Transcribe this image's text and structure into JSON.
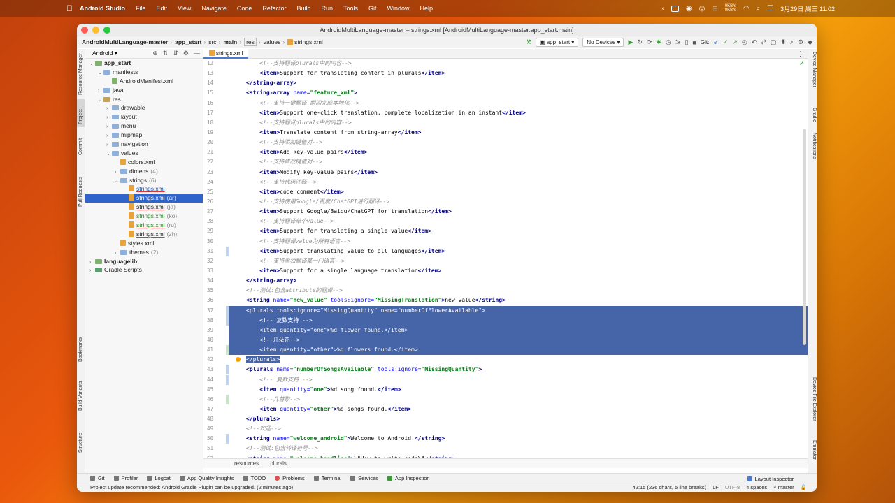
{
  "menubar": {
    "app_name": "Android Studio",
    "items": [
      "File",
      "Edit",
      "View",
      "Navigate",
      "Code",
      "Refactor",
      "Build",
      "Run",
      "Tools",
      "Git",
      "Window",
      "Help"
    ],
    "net_up": "0KB/s",
    "net_down": "0KB/s",
    "clock": "3月29日 周三  11:02"
  },
  "window": {
    "title": "AndroidMultiLanguage-master – strings.xml [AndroidMultiLanguage-master.app_start.main]"
  },
  "navbar": {
    "crumbs": [
      "AndroidMultiLanguage-master",
      "app_start",
      "src",
      "main",
      "res",
      "values",
      "strings.xml"
    ],
    "run_config": "app_start",
    "device": "No Devices",
    "git_label": "Git:"
  },
  "project_panel": {
    "view_mode": "Android",
    "tree": [
      {
        "label": "app_start",
        "extra": "",
        "level": 0,
        "kind": "module",
        "expanded": true
      },
      {
        "label": "manifests",
        "extra": "",
        "level": 1,
        "kind": "folder",
        "expanded": true
      },
      {
        "label": "AndroidManifest.xml",
        "extra": "",
        "level": 2,
        "kind": "manifest"
      },
      {
        "label": "java",
        "extra": "",
        "level": 1,
        "kind": "folder",
        "expanded": false
      },
      {
        "label": "res",
        "extra": "",
        "level": 1,
        "kind": "res",
        "expanded": true
      },
      {
        "label": "drawable",
        "extra": "",
        "level": 2,
        "kind": "folder",
        "expanded": false
      },
      {
        "label": "layout",
        "extra": "",
        "level": 2,
        "kind": "folder",
        "expanded": false
      },
      {
        "label": "menu",
        "extra": "",
        "level": 2,
        "kind": "folder",
        "expanded": false
      },
      {
        "label": "mipmap",
        "extra": "",
        "level": 2,
        "kind": "folder",
        "expanded": false
      },
      {
        "label": "navigation",
        "extra": "",
        "level": 2,
        "kind": "folder",
        "expanded": false
      },
      {
        "label": "values",
        "extra": "",
        "level": 2,
        "kind": "folder",
        "expanded": true
      },
      {
        "label": "colors.xml",
        "extra": "",
        "level": 3,
        "kind": "xml"
      },
      {
        "label": "dimens",
        "extra": "(4)",
        "level": 3,
        "kind": "folder",
        "expanded": false
      },
      {
        "label": "strings",
        "extra": "(6)",
        "level": 3,
        "kind": "folder",
        "expanded": true
      },
      {
        "label": "strings.xml",
        "extra": "",
        "level": 4,
        "kind": "xml",
        "style": "blue"
      },
      {
        "label": "strings.xml",
        "extra": "(ar)",
        "level": 4,
        "kind": "xml",
        "style": "selected"
      },
      {
        "label": "strings.xml",
        "extra": "(ja)",
        "level": 4,
        "kind": "xml",
        "style": "plain"
      },
      {
        "label": "strings.xml",
        "extra": "(ko)",
        "level": 4,
        "kind": "xml",
        "style": "green"
      },
      {
        "label": "strings.xml",
        "extra": "(ru)",
        "level": 4,
        "kind": "xml",
        "style": "green"
      },
      {
        "label": "strings.xml",
        "extra": "(zh)",
        "level": 4,
        "kind": "xml",
        "style": "plain"
      },
      {
        "label": "styles.xml",
        "extra": "",
        "level": 3,
        "kind": "xml"
      },
      {
        "label": "themes",
        "extra": "(2)",
        "level": 3,
        "kind": "folder",
        "expanded": false
      },
      {
        "label": "languagelib",
        "extra": "",
        "level": 0,
        "kind": "module",
        "expanded": false
      },
      {
        "label": "Gradle Scripts",
        "extra": "",
        "level": 0,
        "kind": "gradle",
        "expanded": false
      }
    ]
  },
  "left_tabs": [
    "Resource Manager",
    "Project",
    "Commit",
    "Pull Requests",
    "Bookmarks",
    "Build Variants",
    "Structure"
  ],
  "right_tabs": [
    "Device Manager",
    "Gradle",
    "Notifications",
    "Device File Explorer",
    "Emulator"
  ],
  "editor": {
    "tab_label": "strings.xml",
    "lines": [
      {
        "n": "12",
        "html": "    <span class='cmt'>&lt;!--支持翻译plurals中的内容--&gt;</span>"
      },
      {
        "n": "13",
        "html": "    <span class='tag'>&lt;item&gt;</span>Support for translating content in plurals<span class='tag'>&lt;/item&gt;</span>"
      },
      {
        "n": "14",
        "html": "<span class='tag'>&lt;/string-array&gt;</span>"
      },
      {
        "n": "15",
        "html": "<span class='tag'>&lt;string-array </span><span class='attr'>name=</span><span class='val'>\"feature_xml\"</span><span class='tag'>&gt;</span>"
      },
      {
        "n": "16",
        "html": "    <span class='cmt'>&lt;!--支持一键翻译,瞬间完成本地化--&gt;</span>"
      },
      {
        "n": "17",
        "html": "    <span class='tag'>&lt;item&gt;</span>Support one-click translation, complete localization in an instant<span class='tag'>&lt;/item&gt;</span>"
      },
      {
        "n": "18",
        "html": "    <span class='cmt'>&lt;!--支持翻译plurals中的内容--&gt;</span>"
      },
      {
        "n": "19",
        "html": "    <span class='tag'>&lt;item&gt;</span>Translate content from string-array<span class='tag'>&lt;/item&gt;</span>"
      },
      {
        "n": "20",
        "html": "    <span class='cmt'>&lt;!--支持添加键值对--&gt;</span>"
      },
      {
        "n": "21",
        "html": "    <span class='tag'>&lt;item&gt;</span>Add key-value pairs<span class='tag'>&lt;/item&gt;</span>"
      },
      {
        "n": "22",
        "html": "    <span class='cmt'>&lt;!--支持修改键值对--&gt;</span>"
      },
      {
        "n": "23",
        "html": "    <span class='tag'>&lt;item&gt;</span>Modify key-value pairs<span class='tag'>&lt;/item&gt;</span>"
      },
      {
        "n": "24",
        "html": "    <span class='cmt'>&lt;!--支持代码注释--&gt;</span>"
      },
      {
        "n": "25",
        "html": "    <span class='tag'>&lt;item&gt;</span>code comment<span class='tag'>&lt;/item&gt;</span>"
      },
      {
        "n": "26",
        "html": "    <span class='cmt'>&lt;!--支持使用Google/百度/ChatGPT进行翻译--&gt;</span>"
      },
      {
        "n": "27",
        "html": "    <span class='tag'>&lt;item&gt;</span>Support Google/Baidu/ChatGPT for translation<span class='tag'>&lt;/item&gt;</span>"
      },
      {
        "n": "28",
        "html": "    <span class='cmt'>&lt;!--支持翻译单个value--&gt;</span>"
      },
      {
        "n": "29",
        "html": "    <span class='tag'>&lt;item&gt;</span>Support for translating a single value<span class='tag'>&lt;/item&gt;</span>"
      },
      {
        "n": "30",
        "html": "    <span class='cmt'>&lt;!--支持翻译value为所有语言--&gt;</span>"
      },
      {
        "n": "31",
        "html": "    <span class='tag'>&lt;item&gt;</span>Support translating value to all languages<span class='tag'>&lt;/item&gt;</span>"
      },
      {
        "n": "32",
        "html": "    <span class='cmt'>&lt;!--支持单独翻译某一门语言--&gt;</span>"
      },
      {
        "n": "33",
        "html": "    <span class='tag'>&lt;item&gt;</span>Support for a single language translation<span class='tag'>&lt;/item&gt;</span>"
      },
      {
        "n": "34",
        "html": "<span class='tag'>&lt;/string-array&gt;</span>"
      },
      {
        "n": "35",
        "html": "<span class='cmt'>&lt;!--测试:包含attribute的翻译--&gt;</span>"
      },
      {
        "n": "36",
        "html": "<span class='tag'>&lt;string </span><span class='attr'>name=</span><span class='val'>\"new_value\"</span> <span class='attr'>tools:ignore=</span><span class='val'>\"MissingTranslation\"</span><span class='tag'>&gt;</span>new value<span class='tag'>&lt;/string&gt;</span>"
      },
      {
        "n": "37",
        "html": "&lt;plurals tools:ignore=\"MissingQuantity\" name=\"numberOfFlowerAvailable\"&gt;",
        "hl": true
      },
      {
        "n": "38",
        "html": "    &lt;!-- 复数支持 --&gt;",
        "hl": true
      },
      {
        "n": "39",
        "html": "    &lt;item quantity=\"one\"&gt;%d flower found.&lt;/item&gt;",
        "hl": true
      },
      {
        "n": "40",
        "html": "    &lt;!--几朵花--&gt;",
        "hl": true
      },
      {
        "n": "41",
        "html": "    &lt;item quantity=\"other\"&gt;%d flowers found.&lt;/item&gt;",
        "hl": true
      },
      {
        "n": "42",
        "html": "<span style='background:#4664a8;color:#fff'>&lt;/plurals&gt;</span>",
        "bulb": true
      },
      {
        "n": "43",
        "html": "<span class='tag'>&lt;plurals </span><span class='attr'>name=</span><span class='val'>\"numberOfSongsAvailable\"</span> <span class='attr'>tools:ignore=</span><span class='val'>\"MissingQuantity\"</span><span class='tag'>&gt;</span>"
      },
      {
        "n": "44",
        "html": "    <span class='cmt'>&lt;!-- 复数支持 --&gt;</span>"
      },
      {
        "n": "45",
        "html": "    <span class='tag'>&lt;item </span><span class='attr'>quantity=</span><span class='val'>\"one\"</span><span class='tag'>&gt;</span>%d song found.<span class='tag'>&lt;/item&gt;</span>"
      },
      {
        "n": "46",
        "html": "    <span class='cmt'>&lt;!--几首歌--&gt;</span>"
      },
      {
        "n": "47",
        "html": "    <span class='tag'>&lt;item </span><span class='attr'>quantity=</span><span class='val'>\"other\"</span><span class='tag'>&gt;</span>%d songs found.<span class='tag'>&lt;/item&gt;</span>"
      },
      {
        "n": "48",
        "html": "<span class='tag'>&lt;/plurals&gt;</span>"
      },
      {
        "n": "49",
        "html": "<span class='cmt'>&lt;!--欢迎--&gt;</span>"
      },
      {
        "n": "50",
        "html": "<span class='tag'>&lt;string </span><span class='attr'>name=</span><span class='val'>\"welcome_android\"</span><span class='tag'>&gt;</span>Welcome to Android!<span class='tag'>&lt;/string&gt;</span>"
      },
      {
        "n": "51",
        "html": "<span class='cmt'>&lt;!--测试:包含转译符号--&gt;</span>"
      },
      {
        "n": "52",
        "html": "<span class='tag'>&lt;string </span><span class='attr'>name=</span><span class='val'>\"welcome_headline\"</span><span class='tag'>&gt;</span>\\\"How to write code\\\"<span class='tag'>&lt;/string&gt;</span>"
      }
    ],
    "breadcrumb": [
      "resources",
      "plurals"
    ]
  },
  "bottom_tools": [
    {
      "label": "Git",
      "icon": "git-icon"
    },
    {
      "label": "Profiler",
      "icon": "profiler-icon"
    },
    {
      "label": "Logcat",
      "icon": "logcat-icon"
    },
    {
      "label": "App Quality Insights",
      "icon": "insights-icon"
    },
    {
      "label": "TODO",
      "icon": "todo-icon"
    },
    {
      "label": "Problems",
      "icon": "problems-icon"
    },
    {
      "label": "Terminal",
      "icon": "terminal-icon"
    },
    {
      "label": "Services",
      "icon": "services-icon"
    },
    {
      "label": "App Inspection",
      "icon": "inspection-icon"
    }
  ],
  "layout_inspector": "Layout Inspector",
  "status": {
    "message": "Project update recommended: Android Gradle Plugin can be upgraded. (2 minutes ago)",
    "position": "42:15 (236 chars, 5 line breaks)",
    "line_sep": "LF",
    "encoding": "UTF-8",
    "indent": "4 spaces",
    "branch": "master"
  },
  "colors": {
    "selection": "#4664a8",
    "tree_selected": "#2f65ca",
    "tag": "#000080",
    "attr": "#0000ff",
    "value": "#067d17",
    "comment": "#8c8c8c"
  }
}
